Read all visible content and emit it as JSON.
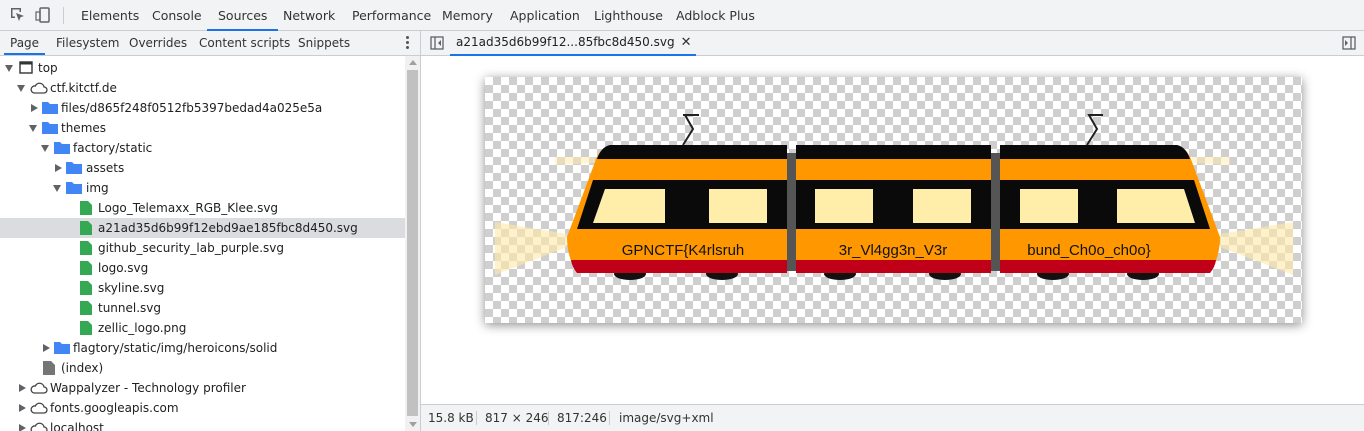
{
  "toolbar": {
    "tabs": [
      {
        "label": "Elements"
      },
      {
        "label": "Console"
      },
      {
        "label": "Sources"
      },
      {
        "label": "Network"
      },
      {
        "label": "Performance"
      },
      {
        "label": "Memory"
      },
      {
        "label": "Application"
      },
      {
        "label": "Lighthouse"
      },
      {
        "label": "Adblock Plus"
      }
    ],
    "active_tab": "Sources",
    "icons": [
      "inspect-element-icon",
      "device-toolbar-icon"
    ]
  },
  "navigator": {
    "tabs": [
      {
        "label": "Page"
      },
      {
        "label": "Filesystem"
      },
      {
        "label": "Overrides"
      },
      {
        "label": "Content scripts"
      },
      {
        "label": "Snippets"
      }
    ],
    "active_tab": "Page",
    "tree": [
      {
        "label": "top",
        "icon": "frame-icon",
        "expanded": true
      },
      {
        "label": "ctf.kitctf.de",
        "icon": "cloud-icon",
        "expanded": true
      },
      {
        "label": "files/d865f248f0512fb5397bedad4a025e5a",
        "icon": "folder-icon",
        "expanded": false
      },
      {
        "label": "themes",
        "icon": "folder-icon",
        "expanded": true
      },
      {
        "label": "factory/static",
        "icon": "folder-icon",
        "expanded": true
      },
      {
        "label": "assets",
        "icon": "folder-icon",
        "expanded": false
      },
      {
        "label": "img",
        "icon": "folder-icon",
        "expanded": true
      },
      {
        "label": "Logo_Telemaxx_RGB_Klee.svg",
        "icon": "image-file-icon"
      },
      {
        "label": "a21ad35d6b99f12ebd9ae185fbc8d450.svg",
        "icon": "image-file-icon",
        "selected": true
      },
      {
        "label": "github_security_lab_purple.svg",
        "icon": "image-file-icon"
      },
      {
        "label": "logo.svg",
        "icon": "image-file-icon"
      },
      {
        "label": "skyline.svg",
        "icon": "image-file-icon"
      },
      {
        "label": "tunnel.svg",
        "icon": "image-file-icon"
      },
      {
        "label": "zellic_logo.png",
        "icon": "image-file-icon"
      },
      {
        "label": "flagtory/static/img/heroicons/solid",
        "icon": "folder-icon",
        "expanded": false
      },
      {
        "label": "(index)",
        "icon": "document-icon"
      },
      {
        "label": "Wappalyzer - Technology profiler",
        "icon": "cloud-icon",
        "expanded": false
      },
      {
        "label": "fonts.googleapis.com",
        "icon": "cloud-icon",
        "expanded": false
      },
      {
        "label": "localhost",
        "icon": "cloud-icon",
        "expanded": false
      }
    ]
  },
  "editor": {
    "open_tab": "a21ad35d6b99f12...85fbc8d450.svg",
    "close_symbol": "✕",
    "image": {
      "segment_texts": [
        "GPNCTF{K4rlsruh",
        "3r_Vl4gg3n_V3r",
        "bund_Ch0o_ch0o}"
      ],
      "colors": {
        "body": "#ff9800",
        "roof": "#0a0a0a",
        "stripe": "#c00018",
        "window": "#ffeeaa",
        "joint": "#555555"
      }
    }
  },
  "status": {
    "size": "15.8 kB",
    "dimensions": "817 × 246",
    "cursor": "817:246",
    "mime": "image/svg+xml"
  }
}
